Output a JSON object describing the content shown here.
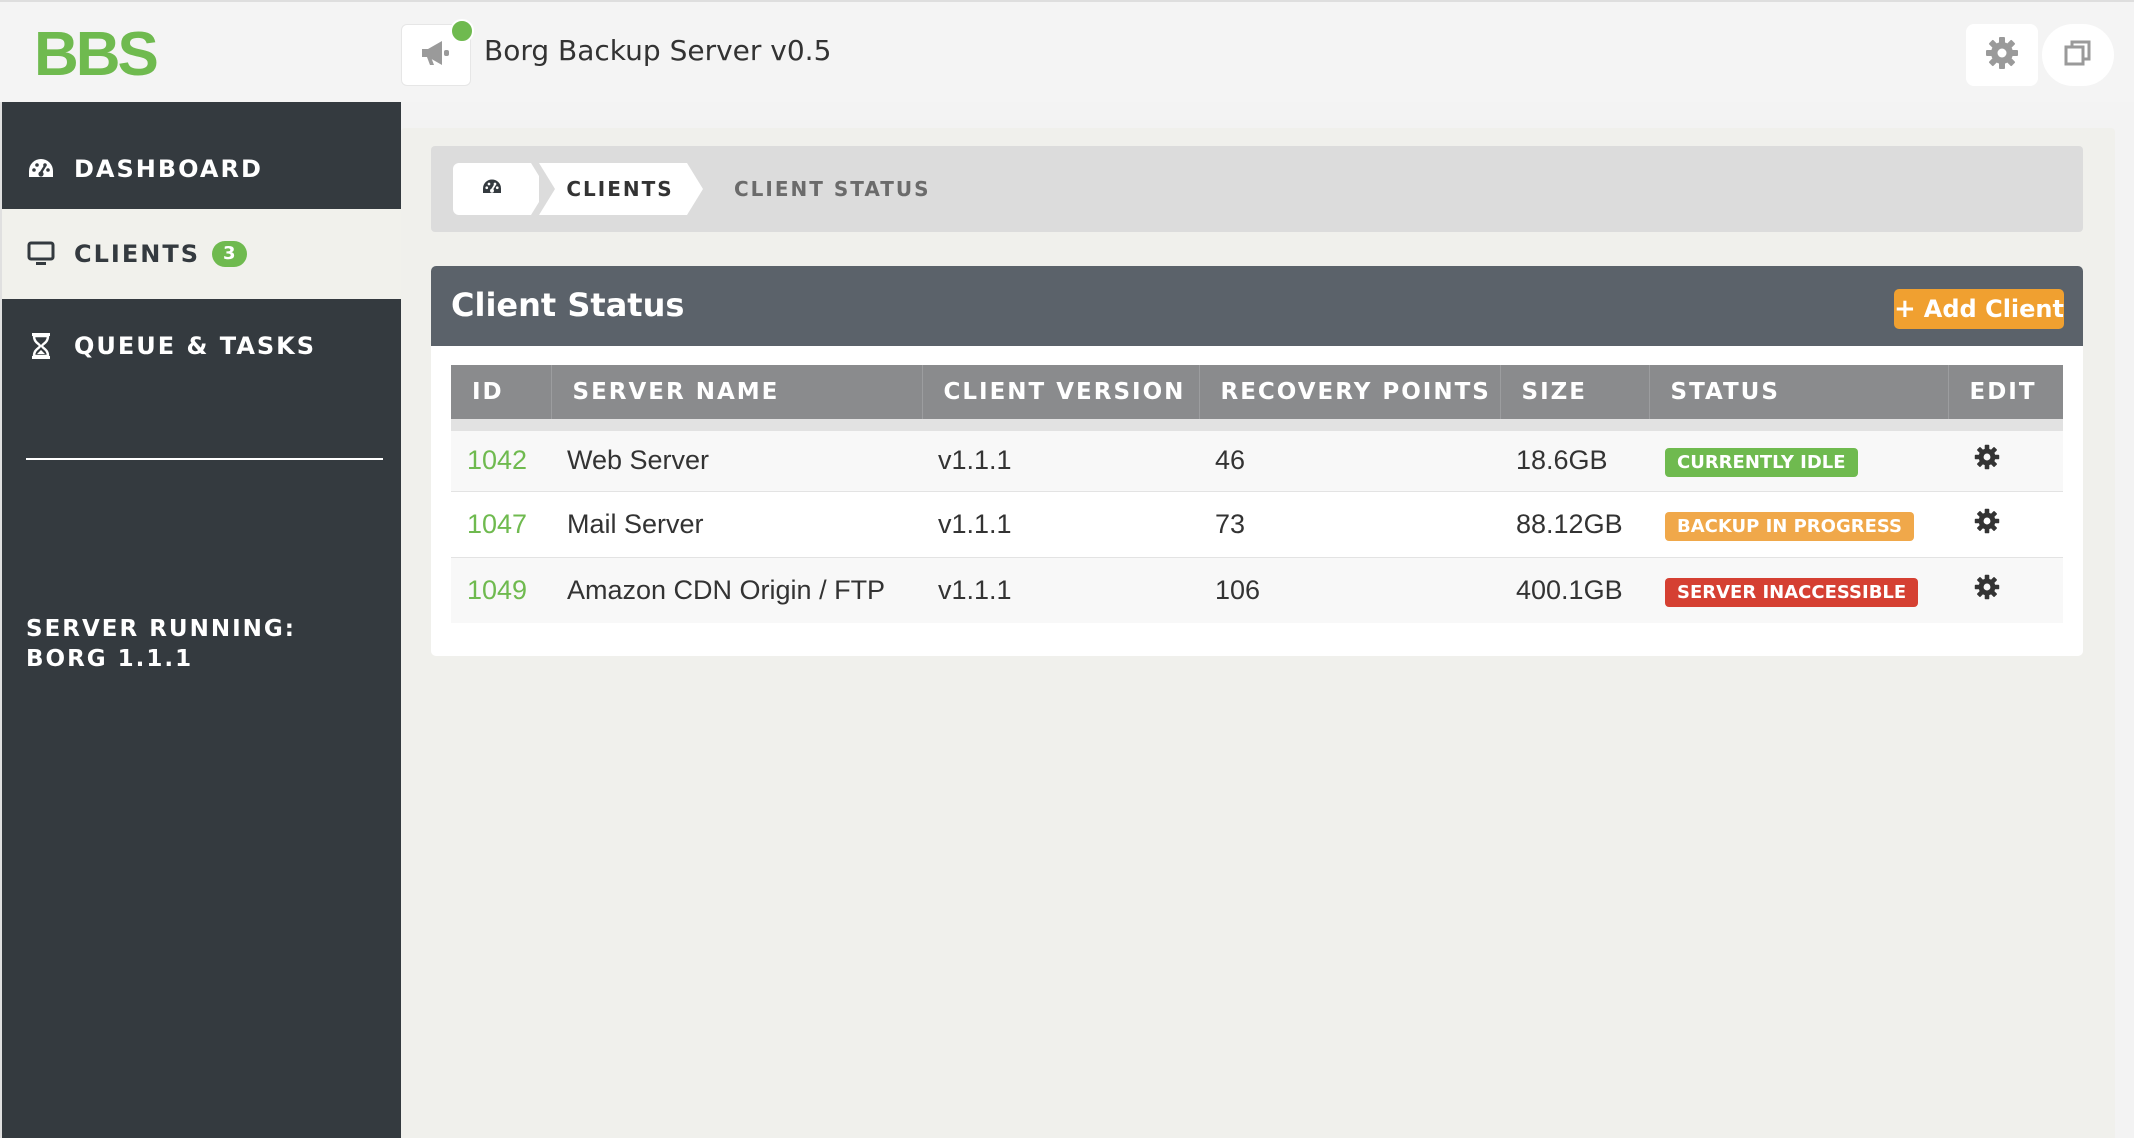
{
  "header": {
    "logo": "BBS",
    "app_title": "Borg Backup Server v0.5",
    "icons": {
      "notification": "megaphone-icon",
      "notification_dot": "#6fba4f",
      "settings": "gear-icon",
      "window": "window-restore-icon"
    }
  },
  "sidebar": {
    "items": [
      {
        "label": "DASHBOARD",
        "icon": "dashboard-gauge-icon",
        "active": false
      },
      {
        "label": "CLIENTS",
        "icon": "monitor-icon",
        "active": true,
        "badge": "3"
      },
      {
        "label": "QUEUE & TASKS",
        "icon": "hourglass-icon",
        "active": false
      }
    ],
    "server_running_line1": "SERVER RUNNING:",
    "server_running_line2": "BORG 1.1.1"
  },
  "breadcrumb": {
    "home_icon": "dashboard-gauge-icon",
    "clients": "CLIENTS",
    "current": "CLIENT STATUS"
  },
  "panel": {
    "title": "Client Status",
    "add_button": {
      "icon": "+",
      "label": "Add Client"
    }
  },
  "table": {
    "columns": [
      "ID",
      "SERVER NAME",
      "CLIENT VERSION",
      "RECOVERY POINTS",
      "SIZE",
      "STATUS",
      "EDIT"
    ],
    "rows": [
      {
        "id": "1042",
        "name": "Web Server",
        "version": "v1.1.1",
        "points": "46",
        "size": "18.6GB",
        "status": "CURRENTLY IDLE",
        "status_color": "#6fba4f"
      },
      {
        "id": "1047",
        "name": "Mail Server",
        "version": "v1.1.1",
        "points": "73",
        "size": "88.12GB",
        "status": "BACKUP IN PROGRESS",
        "status_color": "#f0a84a"
      },
      {
        "id": "1049",
        "name": "Amazon CDN Origin / FTP",
        "version": "v1.1.1",
        "points": "106",
        "size": "400.1GB",
        "status": "SERVER INACCESSIBLE",
        "status_color": "#d54032"
      }
    ]
  },
  "colors": {
    "brand_green": "#6fba4f",
    "sidebar_bg": "#343a3f",
    "panel_header": "#5b626a",
    "accent_orange": "#f0a030"
  }
}
